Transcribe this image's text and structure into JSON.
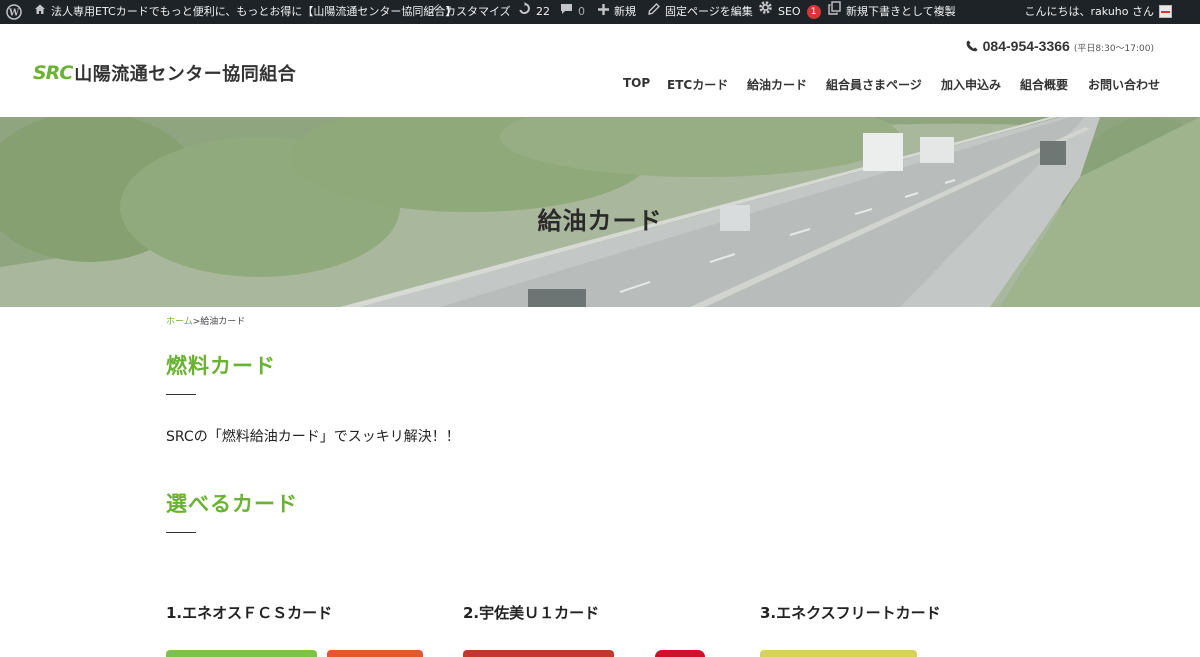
{
  "admin_bar": {
    "site_name": "法人専用ETCカードでもっと便利に、もっとお得に【山陽流通センター協同組合】",
    "customize": "カスタマイズ",
    "updates_count": "22",
    "comments_count": "0",
    "new": "新規",
    "edit_page": "固定ページを編集",
    "seo": "SEO",
    "seo_count": "1",
    "duplicate": "新規下書きとして複製",
    "greeting": "こんにちは、rakuho さん"
  },
  "header": {
    "logo_mark": "SRC",
    "logo_text": "山陽流通センター協同組合",
    "phone": "084-954-3366",
    "hours": "(平日8:30～17:00)",
    "nav": [
      "TOP",
      "ETCカード",
      "給油カード",
      "組合員さまページ",
      "加入申込み",
      "組合概要",
      "お問い合わせ"
    ]
  },
  "hero": {
    "title": "給油カード"
  },
  "breadcrumb": {
    "home": "ホーム",
    "separator": ">",
    "current": "給油カード"
  },
  "sections": {
    "fuel_heading": "燃料カード",
    "lead": "SRCの「燃料給油カード」でスッキリ解決！！",
    "choose_heading": "選べるカード"
  },
  "cards": [
    {
      "title": "1.エネオスＦＣＳカード"
    },
    {
      "title": "2.宇佐美Ｕ１カード"
    },
    {
      "title": "3.エネクスフリートカード"
    }
  ],
  "colors": {
    "accent": "#6ab233",
    "admin_bar": "#1d2327",
    "badge": "#d63638"
  }
}
